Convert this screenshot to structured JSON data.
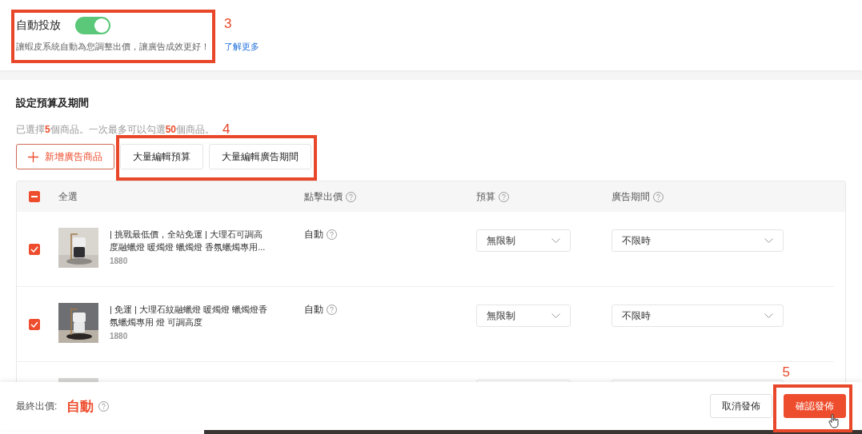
{
  "auto_bidding": {
    "label": "自動投放",
    "on": true,
    "description": "讓蝦皮系統自動為您調整出價，讓廣告成效更好！",
    "link": "了解更多",
    "annotation": "3"
  },
  "budget_section": {
    "title": "設定預算及期間",
    "selection_note": "已選擇**5**個商品。一次最多可以勾選**50**個商品。",
    "add_button": "新增廣告商品",
    "bulk_buttons": [
      "大量編輯預算",
      "大量編輯廣告期間"
    ],
    "annotation": "4"
  },
  "table": {
    "select_all": {
      "label": "全選",
      "indeterminate": true
    },
    "columns": [
      "點擊出價",
      "預算",
      "廣告期間"
    ],
    "rows": [
      {
        "kind": "product",
        "checked": true,
        "name": "| 挑戰最低價，全站免運 | 大理石可調高度融蠟燈 暖燭燈 蠟燭燈 香氛蠟燭專用...",
        "price": "1880",
        "bid": "自動",
        "budget": "無限制",
        "period": "不限時"
      },
      {
        "kind": "product",
        "checked": true,
        "name": "| 免運 | 大理石紋融蠟燈 暖燭燈 蠟燭燈香氛蠟燭專用 燈 可調高度",
        "price": "1880",
        "bid": "自動",
        "budget": "無限制",
        "period": "不限時"
      },
      {
        "kind": "covered"
      }
    ]
  },
  "footer": {
    "final_bid_label": "最終出價:",
    "final_bid_value": "自動",
    "buttons": [
      {
        "label": "取消發佈",
        "primary": false
      },
      {
        "label": "確認發佈",
        "primary": true
      }
    ],
    "annotation": "5"
  }
}
